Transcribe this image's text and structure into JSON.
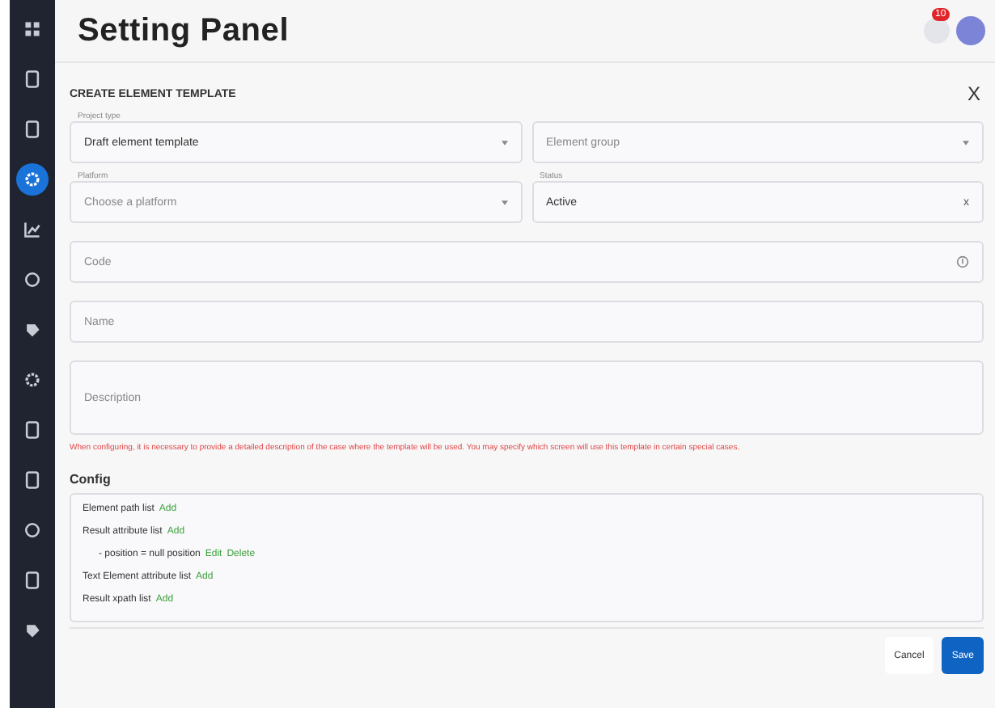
{
  "sidebar": {
    "items": [
      {
        "kind": "grid",
        "selected": false
      },
      {
        "kind": "doc",
        "selected": false
      },
      {
        "kind": "doc",
        "selected": false
      },
      {
        "kind": "gear",
        "selected": true
      },
      {
        "kind": "chart",
        "selected": false
      },
      {
        "kind": "circle",
        "selected": false
      },
      {
        "kind": "tag",
        "selected": false
      },
      {
        "kind": "gear",
        "selected": false
      },
      {
        "kind": "doc",
        "selected": false
      },
      {
        "kind": "doc",
        "selected": false
      },
      {
        "kind": "circle",
        "selected": false
      },
      {
        "kind": "doc",
        "selected": false
      },
      {
        "kind": "tag",
        "selected": false
      }
    ]
  },
  "header": {
    "title": "Setting Panel",
    "notification_count": "10"
  },
  "dialog": {
    "title": "CREATE ELEMENT TEMPLATE",
    "close": "X",
    "rows": [
      [
        {
          "kind": "select",
          "label": "Project type",
          "value": "Draft element template"
        },
        {
          "kind": "select",
          "placeholder": "Element group"
        }
      ],
      [
        {
          "kind": "select",
          "label": "Platform",
          "placeholder": "Choose a platform"
        },
        {
          "kind": "clearable",
          "label": "Status",
          "value": "Active",
          "clear": "x"
        }
      ],
      [
        {
          "kind": "info",
          "placeholder": "Code"
        }
      ],
      [
        {
          "kind": "text",
          "placeholder": "Name"
        }
      ],
      [
        {
          "kind": "area",
          "placeholder": "Description"
        }
      ]
    ],
    "hint": "When configuring, it is necessary to provide a detailed description of the case where the template will be used. You may specify which screen will use this template in certain special cases.",
    "config": {
      "title": "Config",
      "items": [
        {
          "label": "Element path list",
          "actions": [
            "Add"
          ]
        },
        {
          "label": "Result attribute list",
          "actions": [
            "Add"
          ],
          "children": [
            {
              "label": "- position = null position",
              "actions": [
                "Edit",
                "Delete"
              ]
            }
          ]
        },
        {
          "label": "Text Element attribute list",
          "actions": [
            "Add"
          ]
        },
        {
          "label": "Result xpath list",
          "actions": [
            "Add"
          ]
        }
      ]
    },
    "buttons": [
      {
        "label": "Cancel",
        "kind": "secondary"
      },
      {
        "label": "Save",
        "kind": "primary"
      }
    ]
  }
}
